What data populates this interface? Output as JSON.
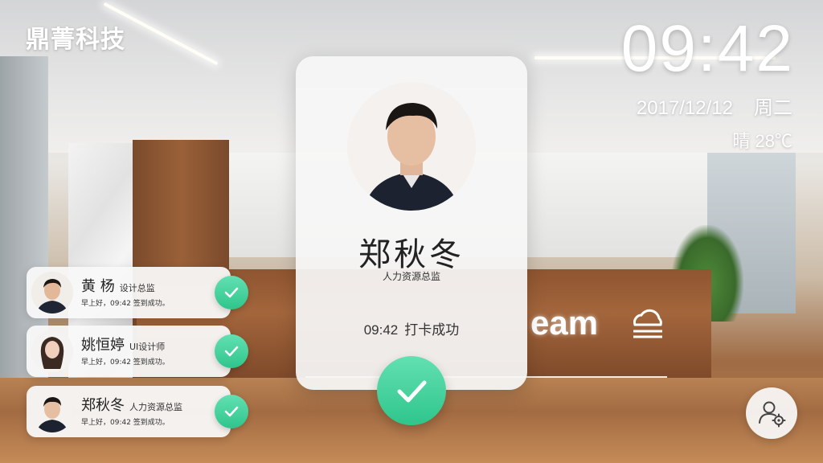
{
  "brand": "鼎菁科技",
  "clock": {
    "time": "09:42",
    "date": "2017/12/12",
    "weekday": "周二",
    "weather": "晴 28℃"
  },
  "background": {
    "desk_sign": "eam"
  },
  "main_card": {
    "name": "郑秋冬",
    "role": "人力资源总监",
    "time": "09:42",
    "status": "打卡成功"
  },
  "checkins": [
    {
      "name": "黄 杨",
      "role": "设计总监",
      "message": "早上好，09:42 签到成功。"
    },
    {
      "name": "姚恒婷",
      "role": "UI设计师",
      "message": "早上好，09:42 签到成功。"
    },
    {
      "name": "郑秋冬",
      "role": "人力资源总监",
      "message": "早上好，09:42 签到成功。"
    }
  ],
  "colors": {
    "success_green": "#3ccf97",
    "card_bg": "#f6f6f6",
    "text_dark": "#222222"
  },
  "icons": {
    "check": "check-icon",
    "settings": "user-settings-icon",
    "cloud": "cloud-icon"
  }
}
